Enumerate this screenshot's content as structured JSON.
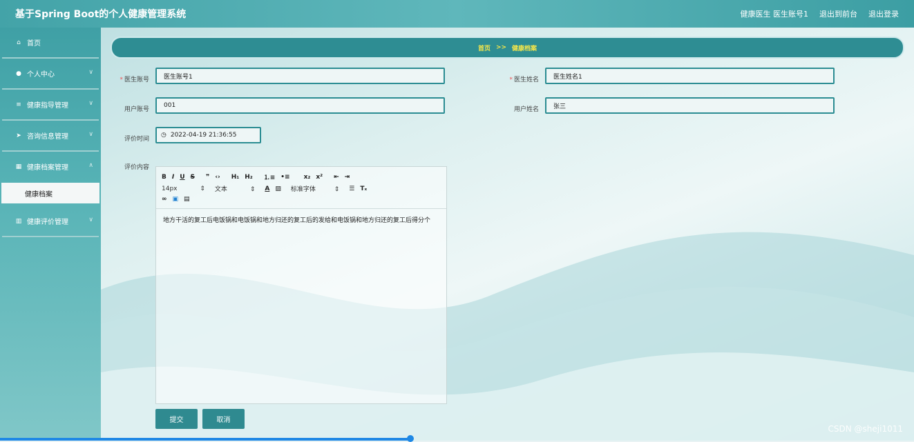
{
  "header": {
    "title": "基于Spring Boot的个人健康管理系统",
    "user_info": "健康医生 医生账号1",
    "back_to_front": "退出到前台",
    "logout": "退出登录"
  },
  "sidebar": {
    "items": [
      {
        "label": "首页",
        "icon": "home-icon"
      },
      {
        "label": "个人中心",
        "icon": "user-icon"
      },
      {
        "label": "健康指导管理",
        "icon": "list-icon"
      },
      {
        "label": "咨询信息管理",
        "icon": "send-icon"
      },
      {
        "label": "健康档案管理",
        "icon": "grid-icon"
      },
      {
        "label": "健康评价管理",
        "icon": "chart-icon"
      }
    ],
    "sub_item": "健康档案"
  },
  "breadcrumb": {
    "home": "首页",
    "separator": ">>",
    "current": "健康档案"
  },
  "form": {
    "doctor_account_label": "医生账号",
    "doctor_account_value": "医生账号1",
    "doctor_name_label": "医生姓名",
    "doctor_name_value": "医生姓名1",
    "user_account_label": "用户账号",
    "user_account_value": "001",
    "user_name_label": "用户姓名",
    "user_name_value": "张三",
    "eval_time_label": "评价时间",
    "eval_time_value": "2022-04-19 21:36:55",
    "eval_content_label": "评价内容"
  },
  "editor": {
    "font_size": "14px",
    "text_type": "文本",
    "font_family": "标准字体",
    "content": "地方干活的复工后电饭锅和电饭锅和地方归还的复工后的发给和电饭锅和地方归还的复工后得分个"
  },
  "buttons": {
    "submit": "提交",
    "cancel": "取消"
  },
  "watermark": "CSDN @sheji1011",
  "colors": {
    "accent": "#2e8d93",
    "header": "#4aa9ad",
    "breadcrumb_text": "#f5e64a"
  }
}
